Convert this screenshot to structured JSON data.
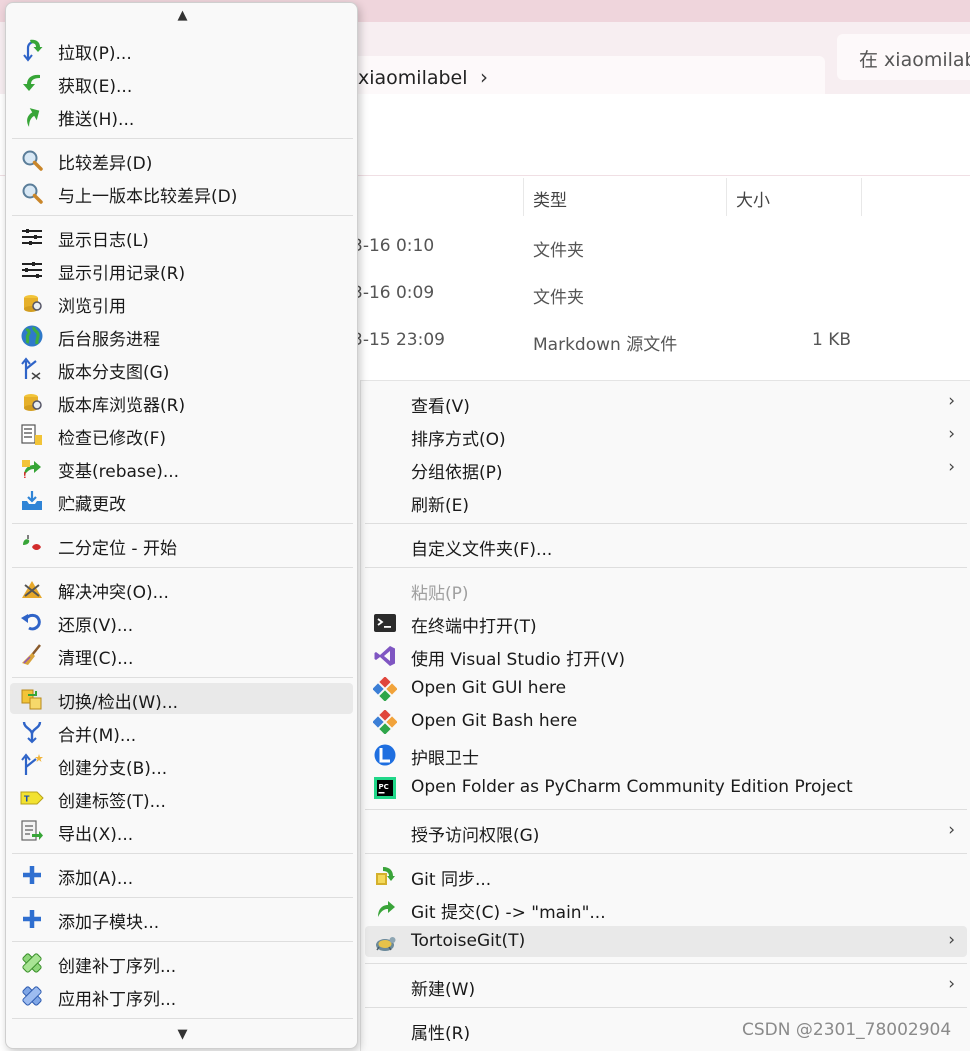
{
  "explorer": {
    "breadcrumb": "xiaomilabel",
    "breadcrumb_chevron": "›",
    "search_placeholder": "在 xiaomilabel",
    "columns": {
      "type": "类型",
      "size": "大小"
    },
    "rows": [
      {
        "date": "3-16 0:10",
        "type": "文件夹",
        "size": ""
      },
      {
        "date": "3-16 0:09",
        "type": "文件夹",
        "size": ""
      },
      {
        "date": "3-15 23:09",
        "type": "Markdown 源文件",
        "size": "1 KB"
      }
    ]
  },
  "tortoise_menu": {
    "scroll_up": "▲",
    "scroll_down": "▼",
    "items": [
      {
        "label": "拉取(P)...",
        "icon": "pull-icon"
      },
      {
        "label": "获取(E)...",
        "icon": "fetch-icon"
      },
      {
        "label": "推送(H)...",
        "icon": "push-icon"
      },
      {
        "label": "比较差异(D)",
        "icon": "diff-magnifier-icon"
      },
      {
        "label": "与上一版本比较差异(D)",
        "icon": "diff-prev-magnifier-icon"
      },
      {
        "label": "显示日志(L)",
        "icon": "log-icon"
      },
      {
        "label": "显示引用记录(R)",
        "icon": "reflog-icon"
      },
      {
        "label": "浏览引用",
        "icon": "browse-refs-icon"
      },
      {
        "label": "后台服务进程",
        "icon": "daemon-globe-icon"
      },
      {
        "label": "版本分支图(G)",
        "icon": "revision-graph-icon"
      },
      {
        "label": "版本库浏览器(R)",
        "icon": "repo-browser-icon"
      },
      {
        "label": "检查已修改(F)",
        "icon": "check-modifications-icon"
      },
      {
        "label": "变基(rebase)...",
        "icon": "rebase-icon"
      },
      {
        "label": "贮藏更改",
        "icon": "stash-icon"
      },
      {
        "label": "二分定位 - 开始",
        "icon": "bisect-icon"
      },
      {
        "label": "解决冲突(O)...",
        "icon": "resolve-conflict-icon"
      },
      {
        "label": "还原(V)...",
        "icon": "revert-icon"
      },
      {
        "label": "清理(C)...",
        "icon": "cleanup-broom-icon"
      },
      {
        "label": "切换/检出(W)...",
        "icon": "switch-checkout-icon"
      },
      {
        "label": "合并(M)...",
        "icon": "merge-icon"
      },
      {
        "label": "创建分支(B)...",
        "icon": "create-branch-icon"
      },
      {
        "label": "创建标签(T)...",
        "icon": "create-tag-icon"
      },
      {
        "label": "导出(X)...",
        "icon": "export-icon"
      },
      {
        "label": "添加(A)...",
        "icon": "add-plus-icon"
      },
      {
        "label": "添加子模块...",
        "icon": "add-submodule-icon"
      },
      {
        "label": "创建补丁序列...",
        "icon": "create-patch-icon"
      },
      {
        "label": "应用补丁序列...",
        "icon": "apply-patch-icon"
      }
    ]
  },
  "context_menu": {
    "submenu_arrow": "›",
    "items": [
      {
        "label": "查看(V)"
      },
      {
        "label": "排序方式(O)"
      },
      {
        "label": "分组依据(P)"
      },
      {
        "label": "刷新(E)"
      },
      {
        "label": "自定义文件夹(F)..."
      },
      {
        "label": "粘贴(P)"
      },
      {
        "label": "在终端中打开(T)",
        "icon": "terminal-icon"
      },
      {
        "label": "使用 Visual Studio 打开(V)",
        "icon": "visual-studio-icon"
      },
      {
        "label": "Open Git GUI here",
        "icon": "git-gui-icon"
      },
      {
        "label": "Open Git Bash here",
        "icon": "git-bash-icon"
      },
      {
        "label": "护眼卫士",
        "icon": "eye-guard-icon"
      },
      {
        "label": "Open Folder as PyCharm Community Edition Project",
        "icon": "pycharm-icon"
      },
      {
        "label": "授予访问权限(G)"
      },
      {
        "label": "Git 同步...",
        "icon": "git-sync-icon"
      },
      {
        "label": "Git 提交(C) -> \"main\"...",
        "icon": "git-commit-icon"
      },
      {
        "label": "TortoiseGit(T)",
        "icon": "tortoisegit-icon"
      },
      {
        "label": "新建(W)"
      },
      {
        "label": "属性(R)"
      }
    ]
  },
  "watermark": "CSDN @2301_78002904"
}
